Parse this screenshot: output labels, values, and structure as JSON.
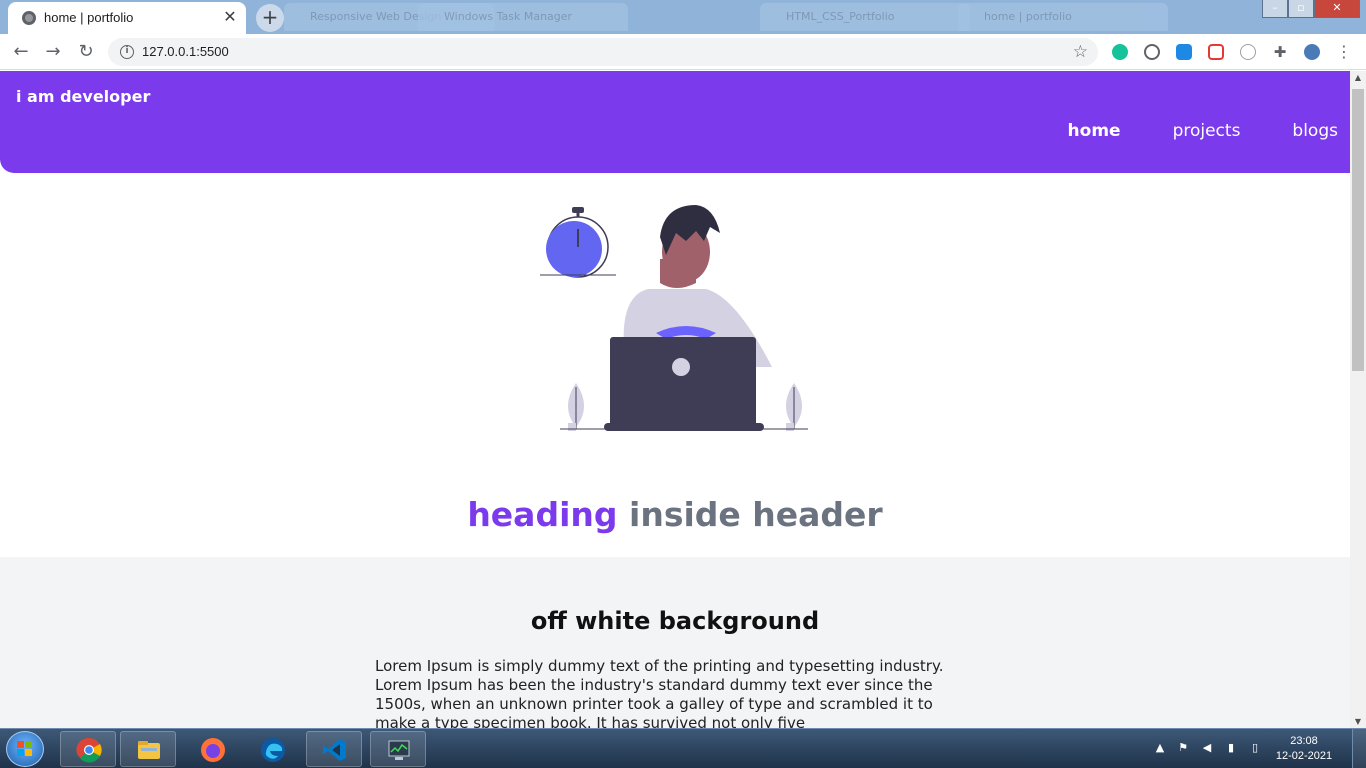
{
  "browser": {
    "active_tab_title": "home | portfolio",
    "background_tabs": [
      "Responsive Web Design",
      "Windows Task Manager",
      "HTML_CSS_Portfolio",
      "home | portfolio"
    ],
    "new_tab_symbol": "+",
    "close_symbol": "✕",
    "url": "127.0.0.1:5500",
    "icons": [
      "back-arrow-icon",
      "forward-arrow-icon",
      "reload-icon",
      "info-icon",
      "bookmark-star-icon",
      "extensions-icon",
      "menu-icon"
    ]
  },
  "site": {
    "brand": "i am developer",
    "nav": [
      {
        "label": "home",
        "active": true
      },
      {
        "label": "projects",
        "active": false
      },
      {
        "label": "blogs",
        "active": false
      }
    ],
    "hero": {
      "heading_highlight": "heading",
      "heading_rest": "inside header"
    },
    "section": {
      "title": "off white background",
      "body": "Lorem Ipsum is simply dummy text of the printing and typesetting industry. Lorem Ipsum has been the industry's standard dummy text ever since the 1500s, when an unknown printer took a galley of type and scrambled it to make a type specimen book. It has survived not only five"
    },
    "colors": {
      "accent": "#7c3aed",
      "muted": "#6b7280",
      "offwhite": "#f3f4f6"
    }
  },
  "taskbar": {
    "time": "23:08",
    "date": "12-02-2021",
    "apps": [
      "chrome-icon",
      "file-explorer-icon",
      "firefox-icon",
      "edge-icon",
      "vscode-icon",
      "task-manager-icon"
    ]
  }
}
